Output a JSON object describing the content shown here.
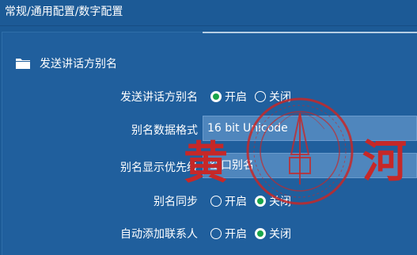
{
  "breadcrumb": "常规/通用配置/数字配置",
  "section": {
    "title": "发送讲话方别名",
    "icon": "folder-icon"
  },
  "rows": [
    {
      "label": "发送讲话方别名",
      "type": "radio",
      "options": [
        "开启",
        "关闭"
      ],
      "selected": 0
    },
    {
      "label": "别名数据格式",
      "type": "field",
      "value": "16 bit Unicode"
    },
    {
      "label": "别名显示优先级",
      "type": "field",
      "value": "空口别名"
    },
    {
      "label": "别名同步",
      "type": "radio",
      "options": [
        "开启",
        "关闭"
      ],
      "selected": 1
    },
    {
      "label": "自动添加联系人",
      "type": "radio",
      "options": [
        "开启",
        "关闭"
      ],
      "selected": 1
    }
  ],
  "stamp": {
    "chars": [
      "黄",
      "河"
    ],
    "color": "#c62828"
  },
  "colors": {
    "background": "#1c5a96",
    "panel": "#205f9d",
    "field": "#4f86bd",
    "radio_on": "#1aa54a"
  }
}
